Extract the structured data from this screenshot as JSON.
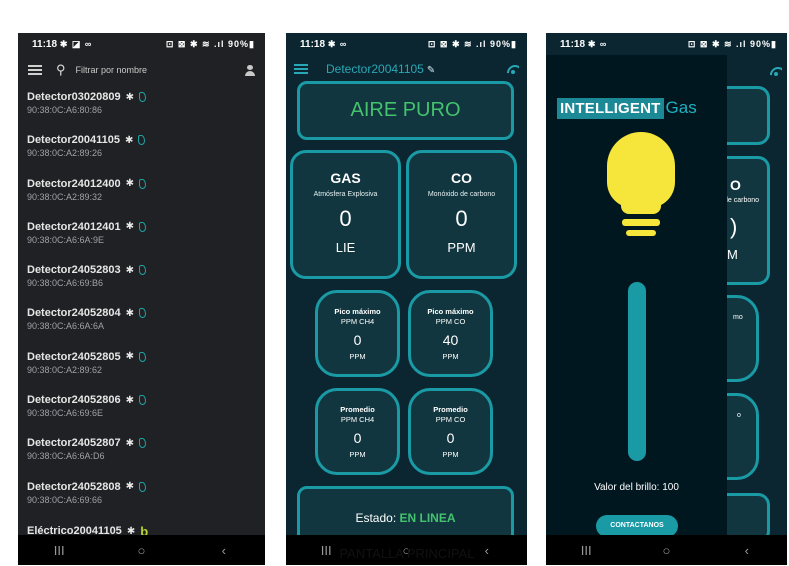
{
  "phone1": {
    "status": {
      "time": "11:18",
      "icons": "✱ ◪ ∞",
      "right": "⊡ ⊠ ✱ ≋ .ıl 90%▮"
    },
    "search": {
      "placeholder": "Filtrar por nombre"
    },
    "devices": [
      {
        "name": "Detector03020809",
        "mac": "90:38:0C:A6:80:86",
        "icon": "flame-icon"
      },
      {
        "name": "Detector20041105",
        "mac": "90:38:0C:A2:89:26",
        "icon": "flame-icon"
      },
      {
        "name": "Detector24012400",
        "mac": "90:38:0C:A2:89:32",
        "icon": "flame-icon"
      },
      {
        "name": "Detector24012401",
        "mac": "90:38:0C:A6:6A:9E",
        "icon": "flame-icon"
      },
      {
        "name": "Detector24052803",
        "mac": "90:38:0C:A6:69:B6",
        "icon": "flame-icon"
      },
      {
        "name": "Detector24052804",
        "mac": "90:38:0C:A6:6A:6A",
        "icon": "flame-icon"
      },
      {
        "name": "Detector24052805",
        "mac": "90:38:0C:A2:89:62",
        "icon": "flame-icon"
      },
      {
        "name": "Detector24052806",
        "mac": "90:38:0C:A6:69:6E",
        "icon": "flame-icon"
      },
      {
        "name": "Detector24052807",
        "mac": "90:38:0C:A6:6A:D6",
        "icon": "flame-icon"
      },
      {
        "name": "Detector24052808",
        "mac": "90:38:0C:A6:69:66",
        "icon": "flame-icon"
      },
      {
        "name": "Eléctrico20041105",
        "mac": "",
        "icon": "b-icon"
      }
    ],
    "nav": [
      "III",
      "○",
      "‹"
    ]
  },
  "phone2": {
    "status": {
      "time": "11:18",
      "icons": "✱ ∞",
      "right": "⊡ ⊠ ✱ ≋ .ıl 90%▮"
    },
    "title": "Detector20041105",
    "air_status": "AIRE PURO",
    "gas": {
      "title": "GAS",
      "subtitle": "Atmósfera Explosiva",
      "value": "0",
      "unit": "LIE"
    },
    "co": {
      "title": "CO",
      "subtitle": "Monóxido de carbono",
      "value": "0",
      "unit": "PPM"
    },
    "peak_ch4": {
      "title": "Pico máximo",
      "subtitle": "PPM CH4",
      "value": "0",
      "unit": "PPM"
    },
    "peak_co": {
      "title": "Pico máximo",
      "subtitle": "PPM CO",
      "value": "40",
      "unit": "PPM"
    },
    "avg_ch4": {
      "title": "Promedio",
      "subtitle": "PPM CH4",
      "value": "0",
      "unit": "PPM"
    },
    "avg_co": {
      "title": "Promedio",
      "subtitle": "PPM CO",
      "value": "0",
      "unit": "PPM"
    },
    "estado_label": "Estado:",
    "estado_value": "EN LINEA",
    "nav": [
      "III",
      "○",
      "‹"
    ]
  },
  "caption": "PANTALLA PRINCIPAL",
  "phone3": {
    "status": {
      "time": "11:18",
      "icons": "✱ ∞",
      "right": "⊡ ⊠ ✱ ≋ .ıl 90%▮"
    },
    "logo_text": "INTELLIGENT",
    "logo_gas": "Gas",
    "brightness_label": "Valor del brillo: 100",
    "brightness_value": 100,
    "contact_button": "CONTACTANOS",
    "peek": {
      "co": "O",
      "co_sub": "de carbono",
      "value": ")",
      "unit": "M",
      "t1": "mo",
      "t2": "o"
    },
    "nav": [
      "III",
      "○",
      "‹"
    ]
  },
  "colors": {
    "accent": "#1a9aa5",
    "green": "#44c26d",
    "bulb": "#f6e53a",
    "bg": "#0b2630"
  }
}
